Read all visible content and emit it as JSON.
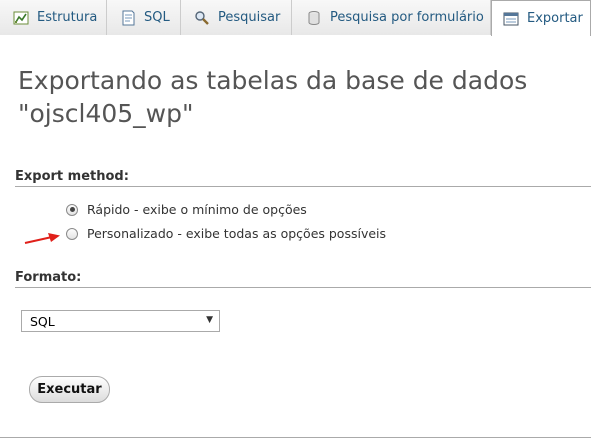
{
  "tabs": [
    {
      "label": "Estrutura",
      "icon": "structure-icon"
    },
    {
      "label": "SQL",
      "icon": "sql-icon"
    },
    {
      "label": "Pesquisar",
      "icon": "search-icon"
    },
    {
      "label": "Pesquisa por formulário",
      "icon": "query-icon"
    },
    {
      "label": "Exportar",
      "icon": "export-icon",
      "active": true
    }
  ],
  "title_line1": "Exportando as tabelas da base de dados",
  "title_line2": "\"ojscl405_wp\"",
  "export_method": {
    "heading": "Export method:",
    "options": [
      {
        "label": "Rápido - exibe o mínimo de opções",
        "selected": true
      },
      {
        "label": "Personalizado - exibe todas as opções possíveis",
        "selected": false
      }
    ]
  },
  "format": {
    "heading": "Formato:",
    "selected": "SQL"
  },
  "execute_button": "Executar",
  "colors": {
    "tab_text": "#235a81",
    "arrow": "#e0201a"
  }
}
